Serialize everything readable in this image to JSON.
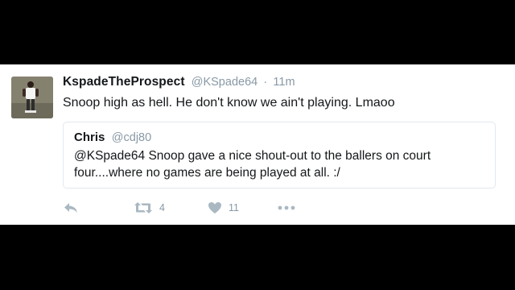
{
  "tweet": {
    "author_name": "KspadeTheProspect",
    "author_handle": "@KSpade64",
    "separator": "·",
    "time": "11m",
    "text": "Snoop high as hell. He don't know we ain't playing. Lmaoo",
    "avatar_icon": "user-photo-avatar"
  },
  "quoted": {
    "author_name": "Chris",
    "author_handle": "@cdj80",
    "text": "@KSpade64 Snoop gave a nice shout-out to the ballers on court four....where no games are being played at all. :/"
  },
  "actions": {
    "reply_icon": "reply-icon",
    "retweet_icon": "retweet-icon",
    "retweet_count": "4",
    "like_icon": "heart-icon",
    "like_count": "11",
    "more_icon": "more-icon"
  },
  "colors": {
    "background": "#000000",
    "card": "#ffffff",
    "text": "#14171a",
    "muted": "#8899a6",
    "icon": "#aab8c2",
    "border": "#e1e8ed"
  }
}
